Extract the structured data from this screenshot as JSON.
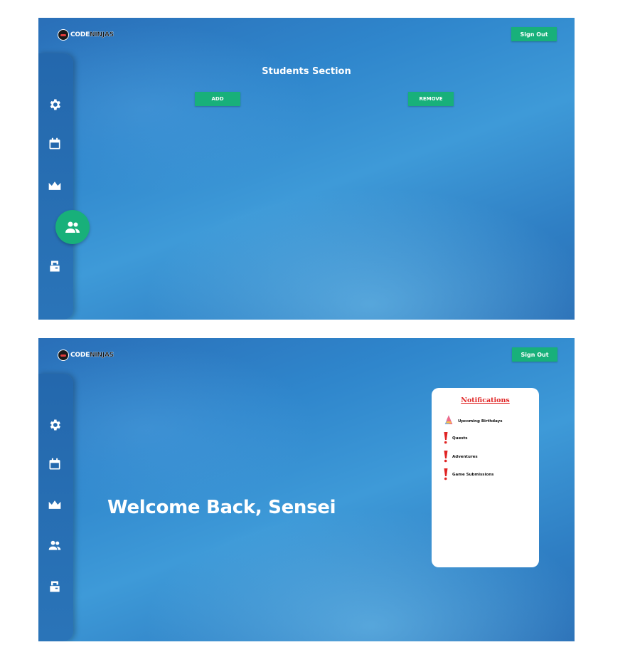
{
  "app": {
    "logo_code": "CODE",
    "logo_ninjas": "NINJAS",
    "sign_out_label": "Sign Out"
  },
  "sidebar": {
    "items": [
      {
        "name": "settings",
        "icon": "gear-icon"
      },
      {
        "name": "calendar",
        "icon": "calendar-icon"
      },
      {
        "name": "leaderboard",
        "icon": "crown-icon"
      },
      {
        "name": "students",
        "icon": "users-icon"
      },
      {
        "name": "logout",
        "icon": "door-exit-icon"
      }
    ],
    "active_item_screen1": "students"
  },
  "students_screen": {
    "title": "Students Section",
    "add_label": "ADD",
    "remove_label": "REMOVE"
  },
  "home_screen": {
    "welcome": "Welcome Back, Sensei",
    "notifications": {
      "title": "Notifications",
      "items": [
        {
          "label": "Upcoming Birthdays",
          "icon": "party-hat-icon"
        },
        {
          "label": "Quests",
          "icon": "exclamation-icon"
        },
        {
          "label": "Adventures",
          "icon": "exclamation-icon"
        },
        {
          "label": "Game Submissions",
          "icon": "exclamation-icon"
        }
      ]
    }
  },
  "colors": {
    "accent_green": "#18b07a",
    "sidebar_blue": "#2468ad",
    "notification_red": "#e02424"
  }
}
